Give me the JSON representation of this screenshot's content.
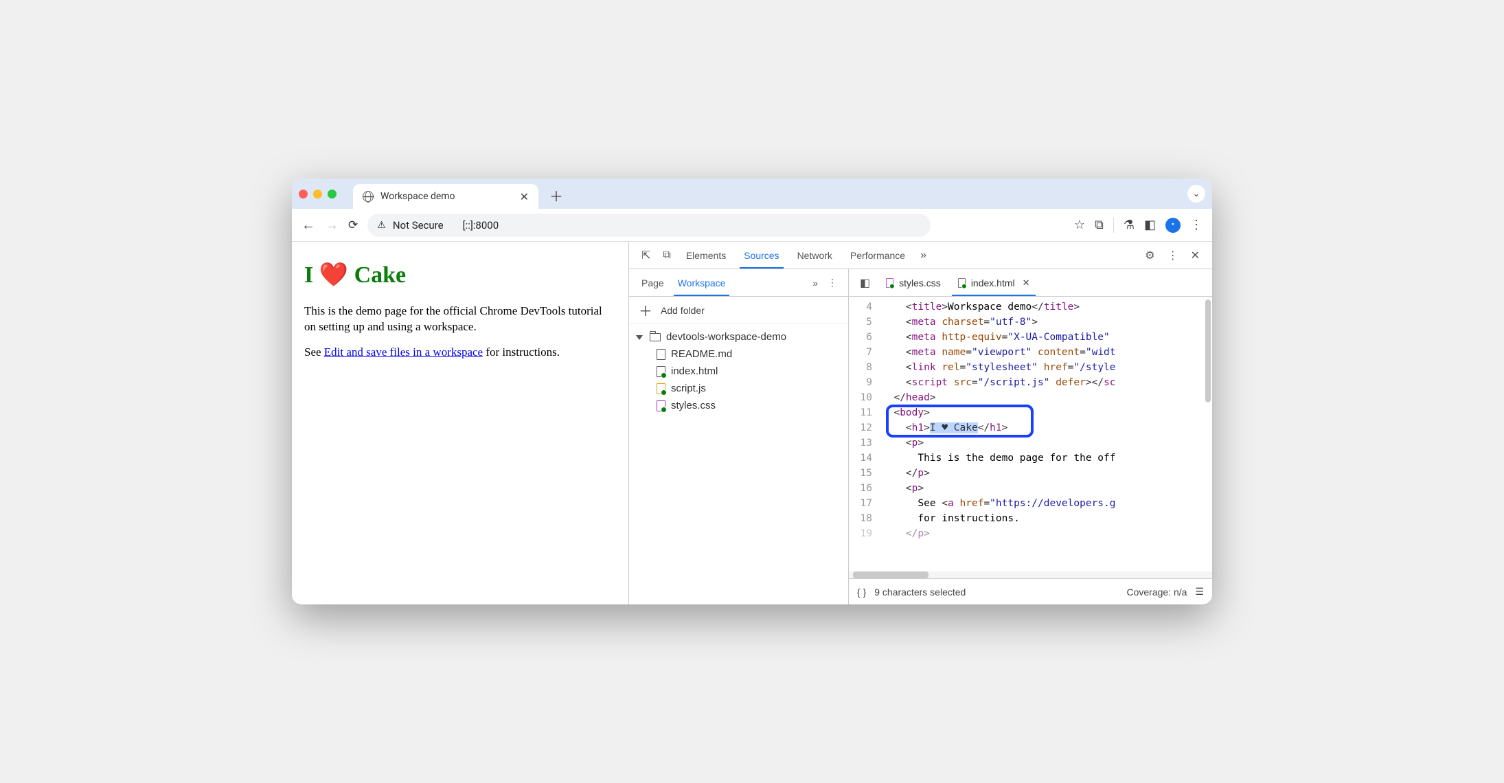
{
  "browser": {
    "tab_title": "Workspace demo",
    "security_label": "Not Secure",
    "url": "[::]:8000"
  },
  "page": {
    "heading": "I ❤️ Cake",
    "para1": "This is the demo page for the official Chrome DevTools tutorial on setting up and using a workspace.",
    "para2_prefix": "See ",
    "para2_link": "Edit and save files in a workspace",
    "para2_suffix": " for instructions."
  },
  "devtools": {
    "tabs": {
      "elements": "Elements",
      "sources": "Sources",
      "network": "Network",
      "performance": "Performance"
    },
    "navigator": {
      "tabs": {
        "page": "Page",
        "workspace": "Workspace"
      },
      "add_folder": "Add folder",
      "folder": "devtools-workspace-demo",
      "files": {
        "readme": "README.md",
        "index": "index.html",
        "script": "script.js",
        "styles": "styles.css"
      }
    },
    "editor_tabs": {
      "styles": "styles.css",
      "index": "index.html"
    },
    "code": {
      "l4": "    <title>Workspace demo</title>",
      "l5": "    <meta charset=\"utf-8\">",
      "l6": "    <meta http-equiv=\"X-UA-Compatible\" ",
      "l7": "    <meta name=\"viewport\" content=\"widt",
      "l8": "    <link rel=\"stylesheet\" href=\"/style",
      "l9": "    <script src=\"/script.js\" defer></sc",
      "l10": "  </head>",
      "l11": "  <body>",
      "l12": "    <h1>I ♥ Cake</h1>",
      "l13": "    <p>",
      "l14": "      This is the demo page for the off",
      "l15": "    </p>",
      "l16": "    <p>",
      "l17": "      See <a href=\"https://developers.g",
      "l18": "      for instructions.",
      "l19": "    </p>"
    },
    "status": {
      "selection": "9 characters selected",
      "coverage": "Coverage: n/a"
    }
  }
}
